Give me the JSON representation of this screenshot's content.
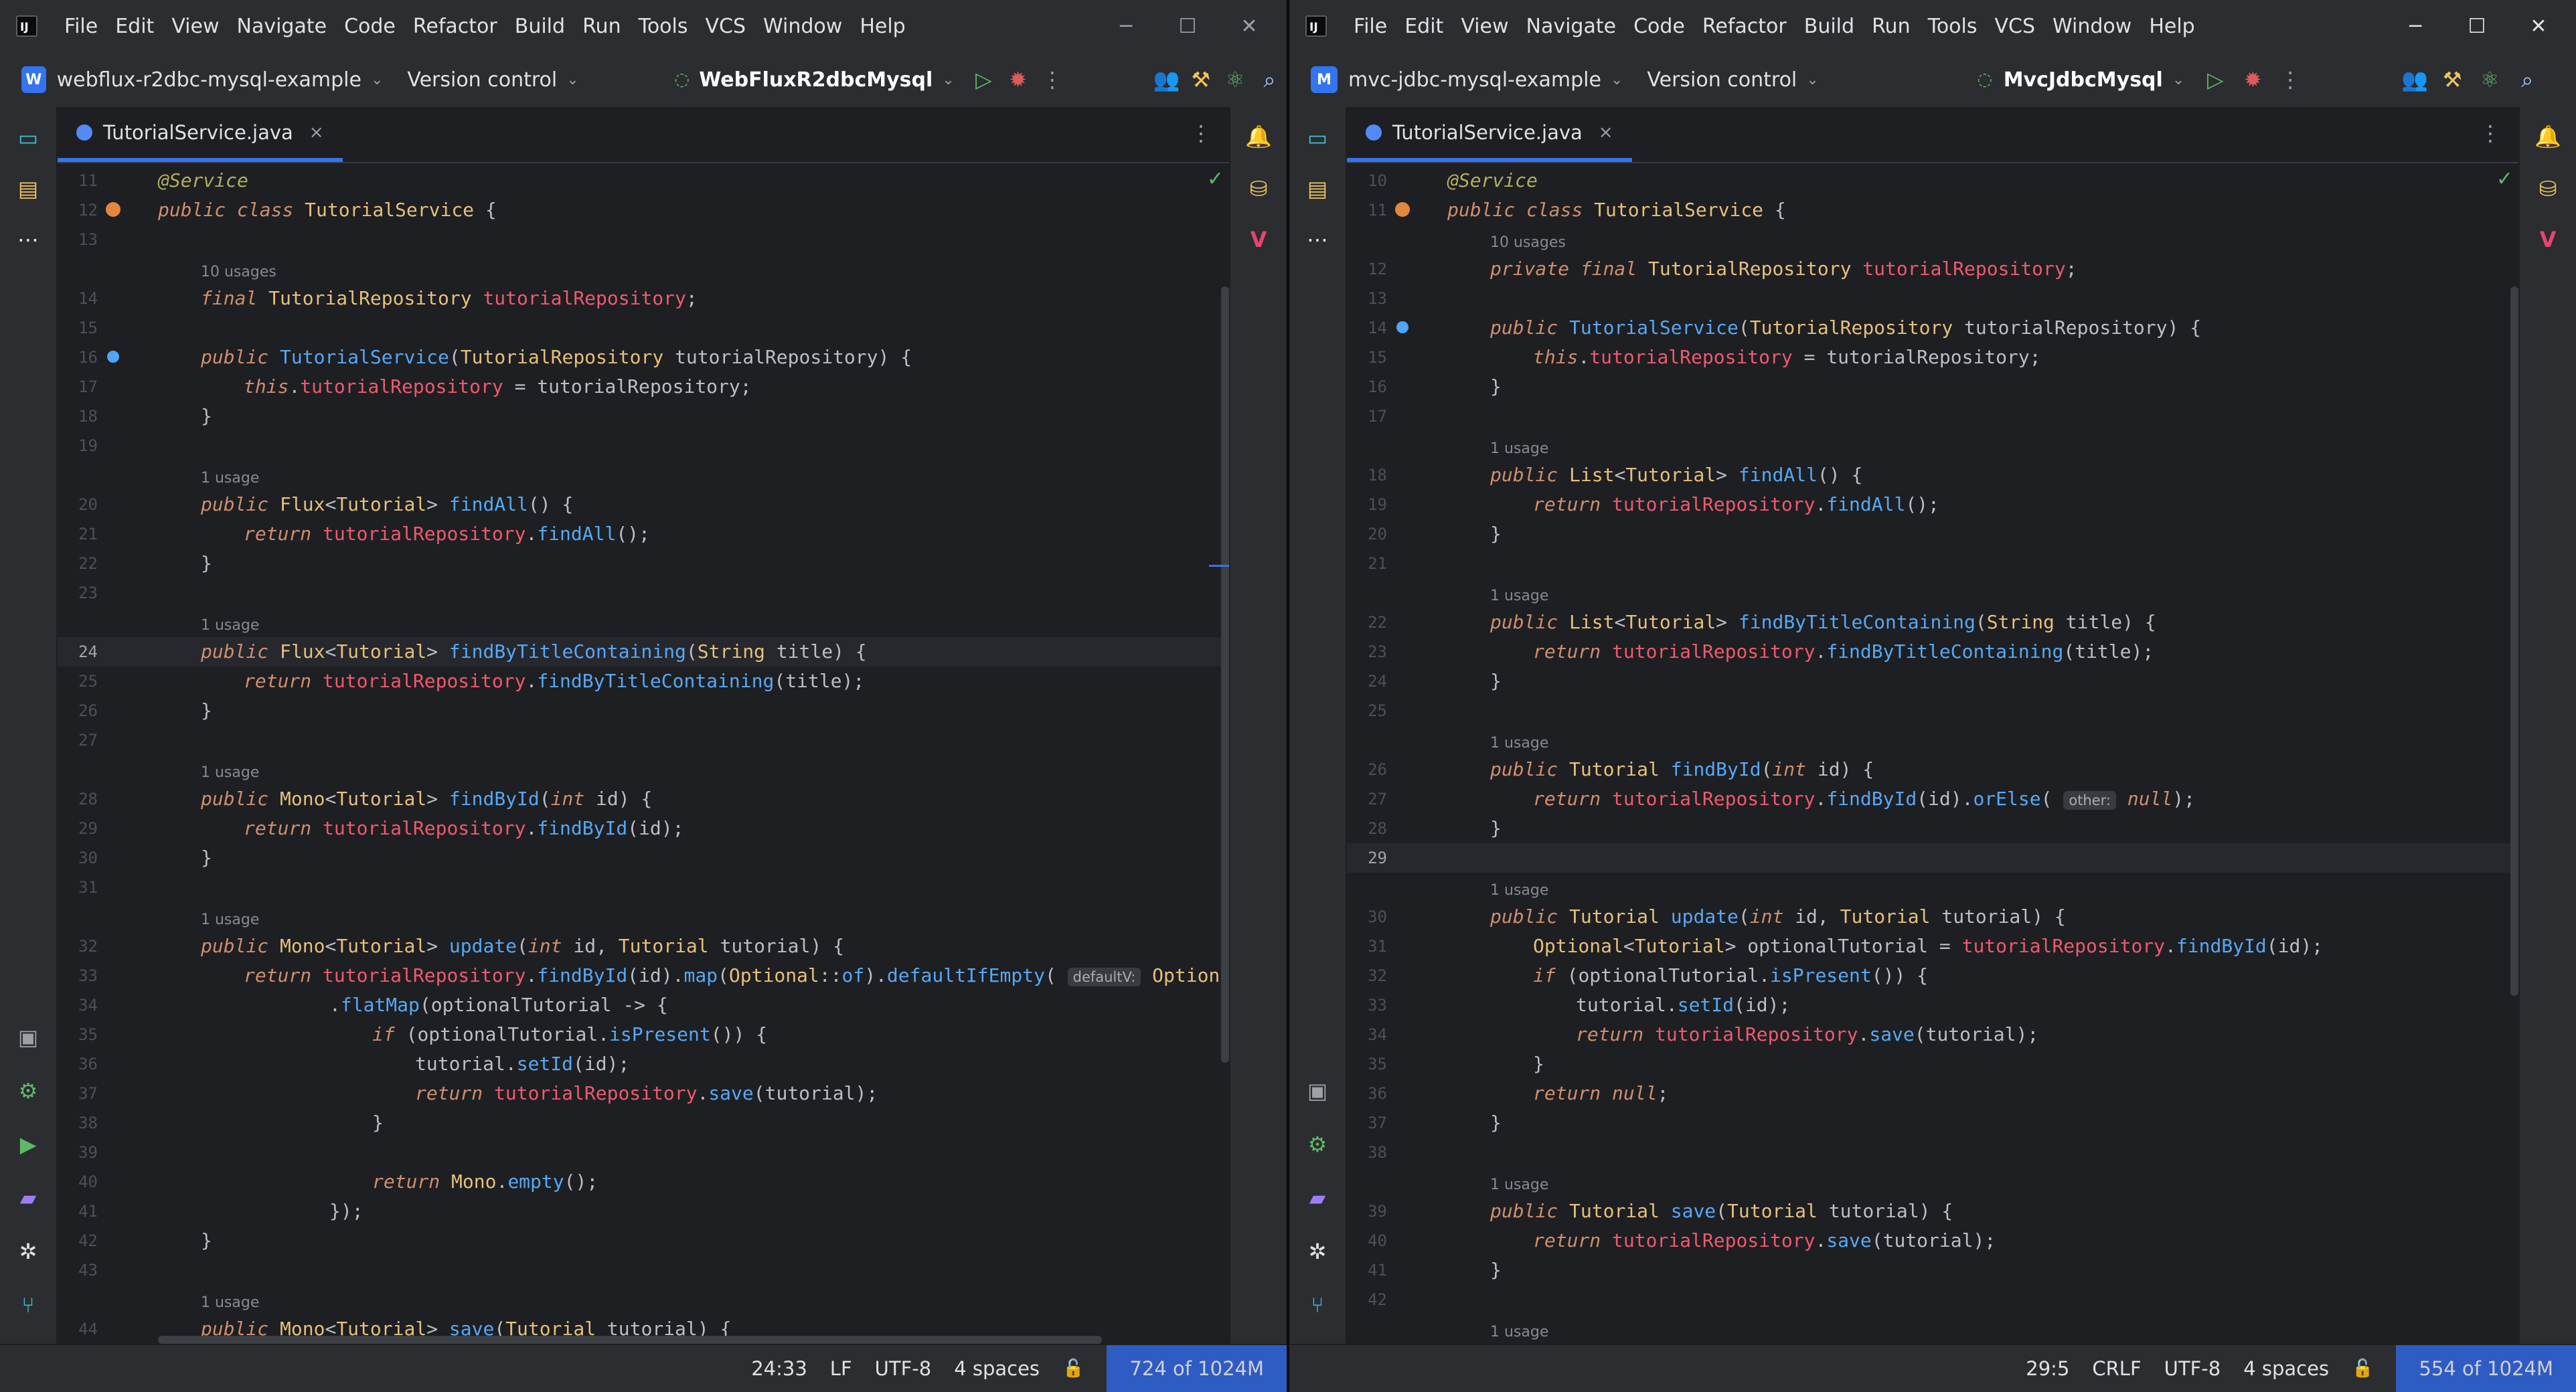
{
  "theme": {
    "accent": "#3574f0",
    "background": "#1e1f22",
    "keyword": "#cf8e6d",
    "field": "#ef596f",
    "method": "#56a8f5",
    "type": "#e5c07b",
    "annotation": "#b3ae60"
  },
  "menu": [
    "File",
    "Edit",
    "View",
    "Navigate",
    "Code",
    "Refactor",
    "Build",
    "Run",
    "Tools",
    "VCS",
    "Window",
    "Help"
  ],
  "left": {
    "project_badge": "W",
    "project_name": "webflux-r2dbc-mysql-example",
    "vcs_label": "Version control",
    "run_config": "WebFluxR2dbcMysql",
    "tab_label": "TutorialService.java",
    "status": {
      "position": "24:33",
      "line_sep": "LF",
      "encoding": "UTF-8",
      "indent": "4 spaces",
      "memory": "724 of 1024M"
    }
  },
  "right": {
    "project_badge": "M",
    "project_name": "mvc-jdbc-mysql-example",
    "vcs_label": "Version control",
    "run_config": "MvcJdbcMysql",
    "tab_label": "TutorialService.java",
    "status": {
      "position": "29:5",
      "line_sep": "CRLF",
      "encoding": "UTF-8",
      "indent": "4 spaces",
      "memory": "554 of 1024M"
    }
  },
  "icons": {
    "toolbar": [
      "vcs-commit-icon",
      "run-icon",
      "debug-icon",
      "more-icon",
      "collab-icon",
      "build-icon",
      "ai-icon",
      "search-icon"
    ],
    "left_strip": [
      "project-icon",
      "structure-icon",
      "more-tools-icon",
      "services-icon",
      "settings-icon",
      "run-tool-icon",
      "terminal-icon",
      "problems-icon",
      "git-icon"
    ],
    "right_strip": [
      "notifications-icon",
      "database-icon",
      "vue-icon"
    ]
  }
}
